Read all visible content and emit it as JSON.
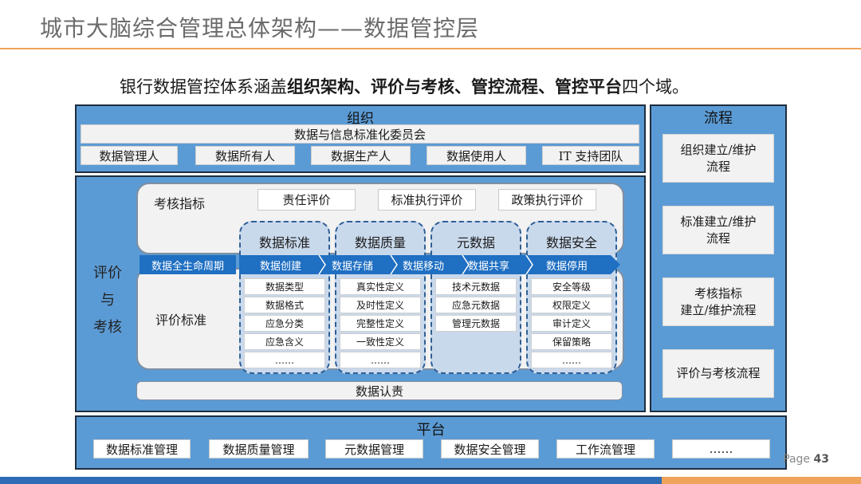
{
  "title": "城市大脑综合管理总体架构——数据管控层",
  "subtitle": {
    "prefix": "银行数据管控体系涵盖",
    "domains": "组织架构、评价与考核、管控流程、管控平台",
    "suffix": "四个域。"
  },
  "organization": {
    "header": "组织",
    "committee": "数据与信息标准化委员会",
    "roles": [
      "数据管理人",
      "数据所有人",
      "数据生产人",
      "数据使用人",
      "IT 支持团队"
    ]
  },
  "evaluation": {
    "side_label": [
      "评价",
      "与",
      "考核"
    ],
    "kpi_label": "考核指标",
    "kpis": [
      "责任评价",
      "标准执行评价",
      "政策执行评价"
    ],
    "standard_label": "评价标准",
    "lifecycle_label": "数据全生命周期",
    "lifecycle_steps": [
      "数据创建",
      "数据存储",
      "数据移动",
      "数据共享",
      "数据停用"
    ],
    "columns": [
      {
        "name": "数据标准",
        "items": [
          "数据类型",
          "数据格式",
          "应急分类",
          "应急含义",
          "……"
        ]
      },
      {
        "name": "数据质量",
        "items": [
          "真实性定义",
          "及时性定义",
          "完整性定义",
          "一致性定义",
          "……"
        ]
      },
      {
        "name": "元数据",
        "items": [
          "技术元数据",
          "应急元数据",
          "管理元数据"
        ]
      },
      {
        "name": "数据安全",
        "items": [
          "安全等级",
          "权限定义",
          "审计定义",
          "保留策略",
          "……"
        ]
      }
    ],
    "accountability": "数据认责"
  },
  "process": {
    "header": "流程",
    "items": [
      "组织建立/维护\n流程",
      "标准建立/维护\n流程",
      "考核指标\n建立/维护流程",
      "评价与考核流程"
    ]
  },
  "platform": {
    "header": "平台",
    "items": [
      "数据标准管理",
      "数据质量管理",
      "元数据管理",
      "数据安全管理",
      "工作流管理",
      "……"
    ]
  },
  "page": {
    "label": "Page",
    "number": "43"
  },
  "colors": {
    "panel": "#5b9bd5",
    "arrow": "#1f6fc2",
    "accent_line": "#f0a35a",
    "bar_blue": "#2e6db4",
    "bar_orange": "#f0a35a"
  }
}
